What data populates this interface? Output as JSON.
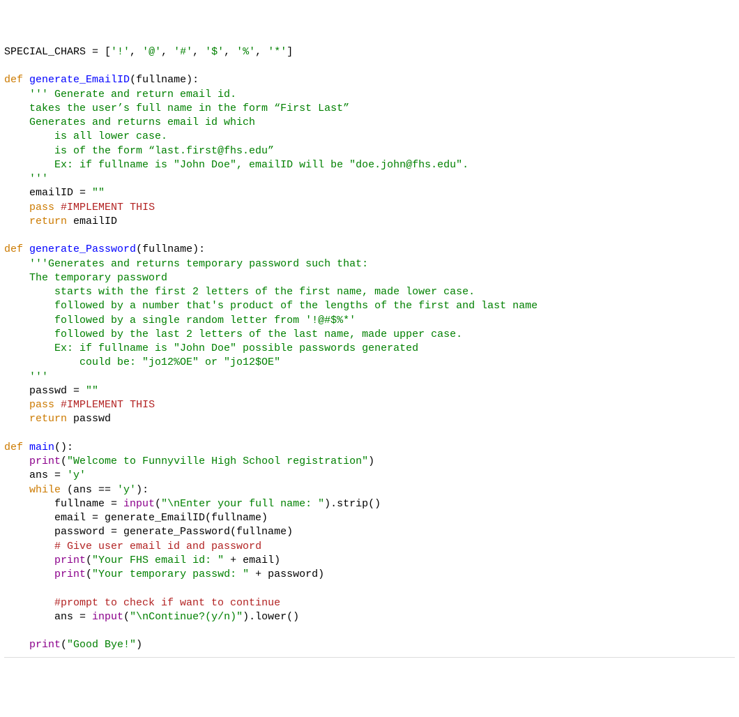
{
  "code": {
    "tokens": [
      [
        {
          "c": "t-default",
          "t": "SPECIAL_CHARS = ["
        },
        {
          "c": "t-string",
          "t": "'!'"
        },
        {
          "c": "t-default",
          "t": ", "
        },
        {
          "c": "t-string",
          "t": "'@'"
        },
        {
          "c": "t-default",
          "t": ", "
        },
        {
          "c": "t-string",
          "t": "'#'"
        },
        {
          "c": "t-default",
          "t": ", "
        },
        {
          "c": "t-string",
          "t": "'$'"
        },
        {
          "c": "t-default",
          "t": ", "
        },
        {
          "c": "t-string",
          "t": "'%'"
        },
        {
          "c": "t-default",
          "t": ", "
        },
        {
          "c": "t-string",
          "t": "'*'"
        },
        {
          "c": "t-default",
          "t": "]"
        }
      ],
      [
        {
          "c": "t-default",
          "t": ""
        }
      ],
      [
        {
          "c": "t-keyword",
          "t": "def"
        },
        {
          "c": "t-default",
          "t": " "
        },
        {
          "c": "t-func",
          "t": "generate_EmailID"
        },
        {
          "c": "t-default",
          "t": "(fullname):"
        }
      ],
      [
        {
          "c": "t-default",
          "t": "    "
        },
        {
          "c": "t-string",
          "t": "''' Generate and return email id."
        }
      ],
      [
        {
          "c": "t-string",
          "t": "    takes the user’s full name in the form “First Last”"
        }
      ],
      [
        {
          "c": "t-string",
          "t": "    Generates and returns email id which"
        }
      ],
      [
        {
          "c": "t-string",
          "t": "        is all lower case."
        }
      ],
      [
        {
          "c": "t-string",
          "t": "        is of the form “last.first@fhs.edu”"
        }
      ],
      [
        {
          "c": "t-string",
          "t": "        Ex: if fullname is \"John Doe\", emailID will be \"doe.john@fhs.edu\"."
        }
      ],
      [
        {
          "c": "t-string",
          "t": "    '''"
        }
      ],
      [
        {
          "c": "t-default",
          "t": "    emailID = "
        },
        {
          "c": "t-string",
          "t": "\"\""
        }
      ],
      [
        {
          "c": "t-default",
          "t": "    "
        },
        {
          "c": "t-keyword",
          "t": "pass"
        },
        {
          "c": "t-default",
          "t": " "
        },
        {
          "c": "t-comment",
          "t": "#IMPLEMENT THIS"
        }
      ],
      [
        {
          "c": "t-default",
          "t": "    "
        },
        {
          "c": "t-keyword",
          "t": "return"
        },
        {
          "c": "t-default",
          "t": " emailID"
        }
      ],
      [
        {
          "c": "t-default",
          "t": ""
        }
      ],
      [
        {
          "c": "t-keyword",
          "t": "def"
        },
        {
          "c": "t-default",
          "t": " "
        },
        {
          "c": "t-func",
          "t": "generate_Password"
        },
        {
          "c": "t-default",
          "t": "(fullname):"
        }
      ],
      [
        {
          "c": "t-default",
          "t": "    "
        },
        {
          "c": "t-string",
          "t": "'''Generates and returns temporary password such that:"
        }
      ],
      [
        {
          "c": "t-string",
          "t": "    The temporary password"
        }
      ],
      [
        {
          "c": "t-string",
          "t": "        starts with the first 2 letters of the first name, made lower case."
        }
      ],
      [
        {
          "c": "t-string",
          "t": "        followed by a number that's product of the lengths of the first and last name"
        }
      ],
      [
        {
          "c": "t-string",
          "t": "        followed by a single random letter from '!@#$%*'"
        }
      ],
      [
        {
          "c": "t-string",
          "t": "        followed by the last 2 letters of the last name, made upper case."
        }
      ],
      [
        {
          "c": "t-string",
          "t": "        Ex: if fullname is \"John Doe\" possible passwords generated"
        }
      ],
      [
        {
          "c": "t-string",
          "t": "            could be: \"jo12%OE\" or \"jo12$OE\""
        }
      ],
      [
        {
          "c": "t-string",
          "t": "    '''"
        }
      ],
      [
        {
          "c": "t-default",
          "t": "    passwd = "
        },
        {
          "c": "t-string",
          "t": "\"\""
        }
      ],
      [
        {
          "c": "t-default",
          "t": "    "
        },
        {
          "c": "t-keyword",
          "t": "pass"
        },
        {
          "c": "t-default",
          "t": " "
        },
        {
          "c": "t-comment",
          "t": "#IMPLEMENT THIS"
        }
      ],
      [
        {
          "c": "t-default",
          "t": "    "
        },
        {
          "c": "t-keyword",
          "t": "return"
        },
        {
          "c": "t-default",
          "t": " passwd"
        }
      ],
      [
        {
          "c": "t-default",
          "t": ""
        }
      ],
      [
        {
          "c": "t-keyword",
          "t": "def"
        },
        {
          "c": "t-default",
          "t": " "
        },
        {
          "c": "t-func",
          "t": "main"
        },
        {
          "c": "t-default",
          "t": "():"
        }
      ],
      [
        {
          "c": "t-default",
          "t": "    "
        },
        {
          "c": "t-builtin",
          "t": "print"
        },
        {
          "c": "t-default",
          "t": "("
        },
        {
          "c": "t-string",
          "t": "\"Welcome to Funnyville High School registration\""
        },
        {
          "c": "t-default",
          "t": ")"
        }
      ],
      [
        {
          "c": "t-default",
          "t": "    ans = "
        },
        {
          "c": "t-string",
          "t": "'y'"
        }
      ],
      [
        {
          "c": "t-default",
          "t": "    "
        },
        {
          "c": "t-keyword",
          "t": "while"
        },
        {
          "c": "t-default",
          "t": " (ans == "
        },
        {
          "c": "t-string",
          "t": "'y'"
        },
        {
          "c": "t-default",
          "t": "):"
        }
      ],
      [
        {
          "c": "t-default",
          "t": "        fullname = "
        },
        {
          "c": "t-builtin",
          "t": "input"
        },
        {
          "c": "t-default",
          "t": "("
        },
        {
          "c": "t-string",
          "t": "\"\\nEnter your full name: \""
        },
        {
          "c": "t-default",
          "t": ").strip()"
        }
      ],
      [
        {
          "c": "t-default",
          "t": "        email = generate_EmailID(fullname)"
        }
      ],
      [
        {
          "c": "t-default",
          "t": "        password = generate_Password(fullname)"
        }
      ],
      [
        {
          "c": "t-default",
          "t": "        "
        },
        {
          "c": "t-comment",
          "t": "# Give user email id and password"
        }
      ],
      [
        {
          "c": "t-default",
          "t": "        "
        },
        {
          "c": "t-builtin",
          "t": "print"
        },
        {
          "c": "t-default",
          "t": "("
        },
        {
          "c": "t-string",
          "t": "\"Your FHS email id: \""
        },
        {
          "c": "t-default",
          "t": " + email)"
        }
      ],
      [
        {
          "c": "t-default",
          "t": "        "
        },
        {
          "c": "t-builtin",
          "t": "print"
        },
        {
          "c": "t-default",
          "t": "("
        },
        {
          "c": "t-string",
          "t": "\"Your temporary passwd: \""
        },
        {
          "c": "t-default",
          "t": " + password)"
        }
      ],
      [
        {
          "c": "t-default",
          "t": ""
        }
      ],
      [
        {
          "c": "t-default",
          "t": "        "
        },
        {
          "c": "t-comment",
          "t": "#prompt to check if want to continue"
        }
      ],
      [
        {
          "c": "t-default",
          "t": "        ans = "
        },
        {
          "c": "t-builtin",
          "t": "input"
        },
        {
          "c": "t-default",
          "t": "("
        },
        {
          "c": "t-string",
          "t": "\"\\nContinue?(y/n)\""
        },
        {
          "c": "t-default",
          "t": ").lower()"
        }
      ],
      [
        {
          "c": "t-default",
          "t": ""
        }
      ],
      [
        {
          "c": "t-default",
          "t": "    "
        },
        {
          "c": "t-builtin",
          "t": "print"
        },
        {
          "c": "t-default",
          "t": "("
        },
        {
          "c": "t-string",
          "t": "\"Good Bye!\""
        },
        {
          "c": "t-default",
          "t": ")"
        }
      ]
    ]
  }
}
